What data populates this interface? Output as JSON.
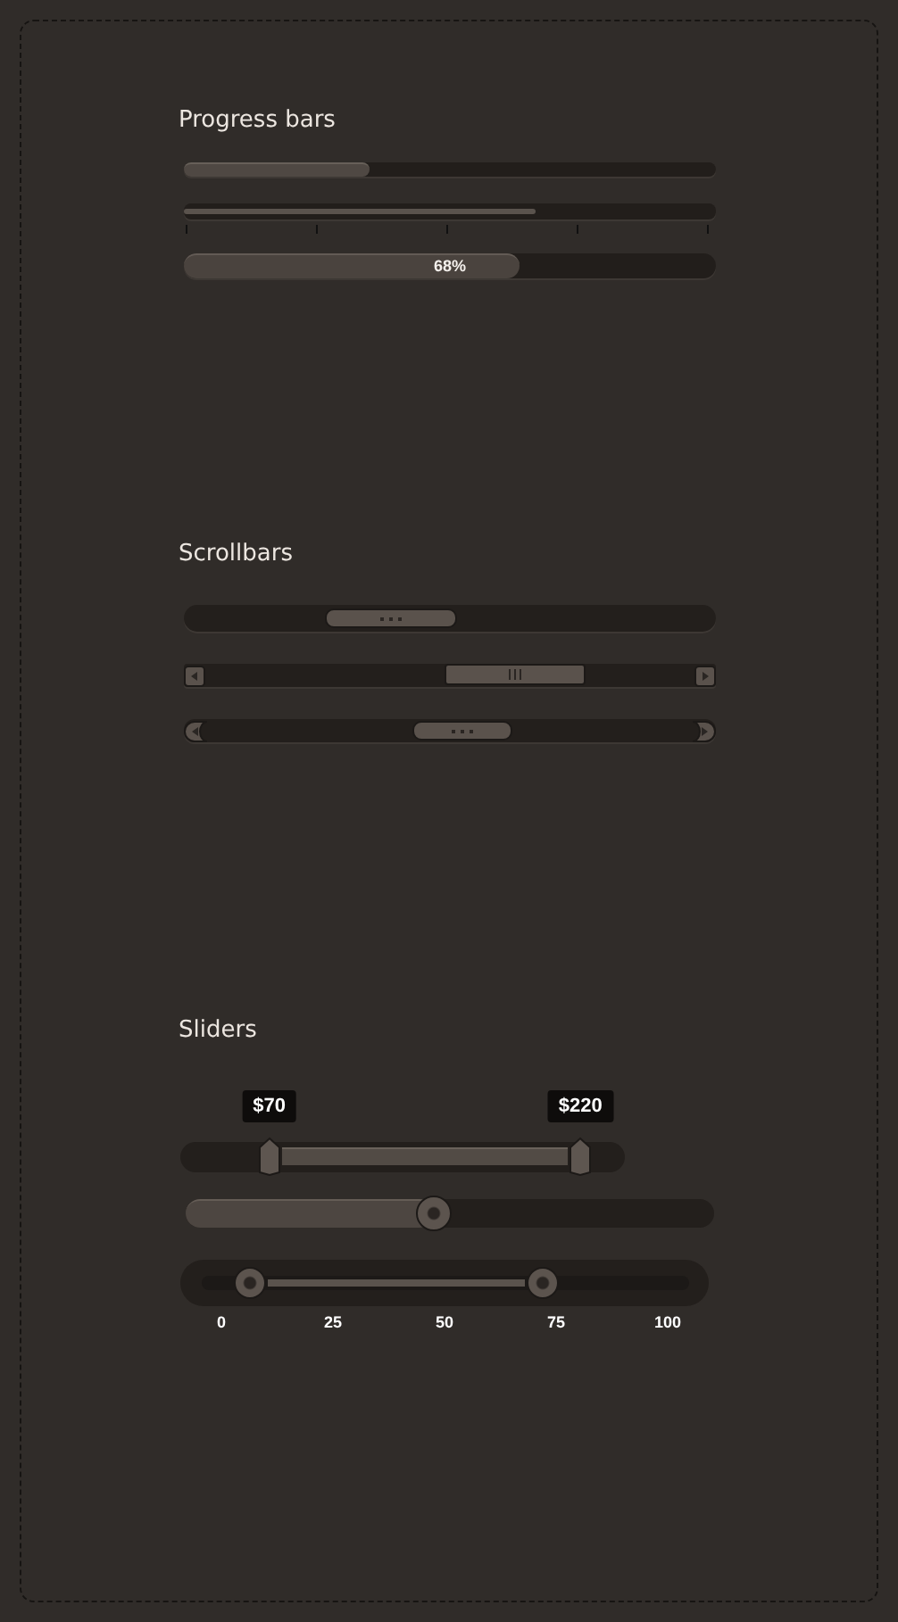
{
  "progress": {
    "title": "Progress bars",
    "bars": [
      {
        "kind": "thin",
        "level": 0.35
      },
      {
        "kind": "ticked",
        "level": 0.66
      },
      {
        "kind": "labeled",
        "level": 0.63,
        "label": "68%"
      }
    ]
  },
  "scrollbars": {
    "title": "Scrollbars",
    "bars": [
      {
        "kind": "rounded"
      },
      {
        "kind": "arrows"
      },
      {
        "kind": "capped"
      }
    ]
  },
  "sliders": {
    "title": "Sliders",
    "items": [
      {
        "kind": "range-tooltip",
        "thumbs": [
          {
            "label": "$70",
            "level": 0.2
          },
          {
            "label": "$220",
            "level": 0.9
          }
        ]
      },
      {
        "kind": "single",
        "level": 0.47
      },
      {
        "kind": "range-scale",
        "thumbs": [
          {
            "level": 0.1
          },
          {
            "level": 0.7
          }
        ],
        "scale": [
          "0",
          "25",
          "50",
          "75",
          "100"
        ]
      }
    ]
  }
}
